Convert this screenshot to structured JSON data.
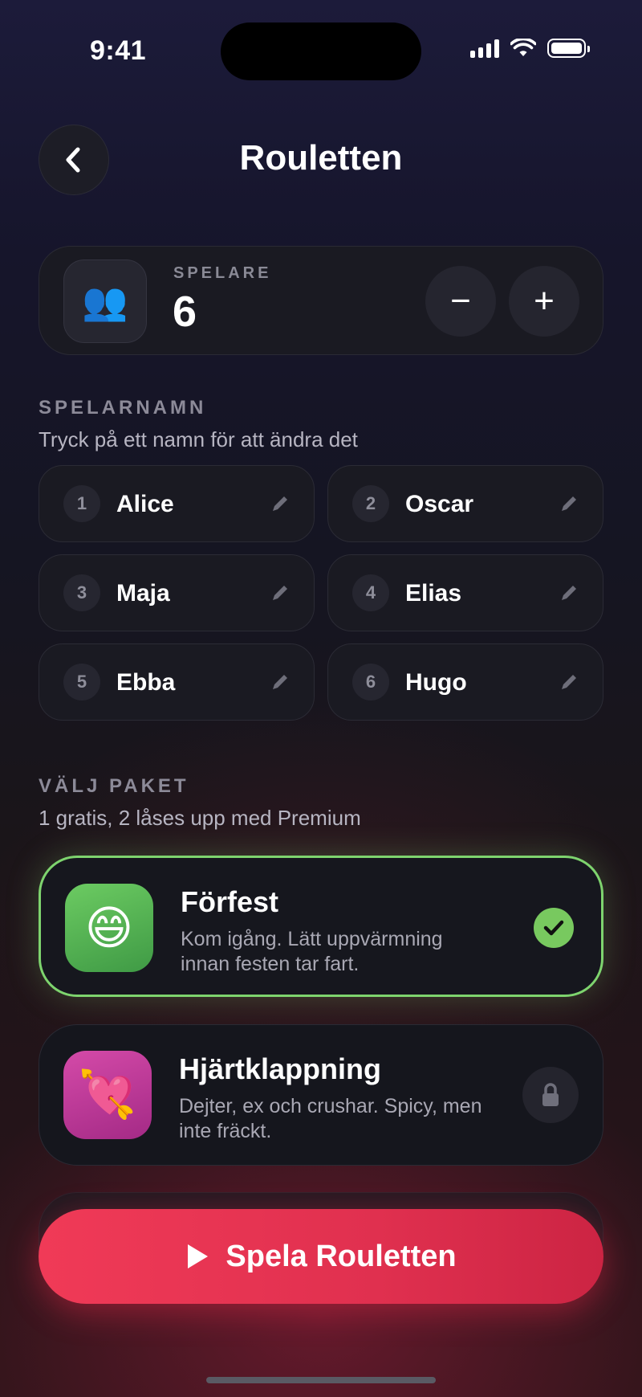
{
  "status_bar": {
    "time": "9:41"
  },
  "header": {
    "title": "Rouletten"
  },
  "players": {
    "label": "SPELARE",
    "count": "6",
    "minus": "−",
    "plus": "+",
    "icon": "people-icon"
  },
  "names_section": {
    "label": "SPELARNAMN",
    "subtitle": "Tryck på ett namn för att ändra det",
    "players": [
      {
        "num": "1",
        "name": "Alice"
      },
      {
        "num": "2",
        "name": "Oscar"
      },
      {
        "num": "3",
        "name": "Maja"
      },
      {
        "num": "4",
        "name": "Elias"
      },
      {
        "num": "5",
        "name": "Ebba"
      },
      {
        "num": "6",
        "name": "Hugo"
      }
    ]
  },
  "packages_section": {
    "label": "VÄLJ PAKET",
    "subtitle": "1 gratis, 2 låses upp med Premium",
    "packages": [
      {
        "title": "Förfest",
        "desc": "Kom igång. Lätt uppvärmning innan festen tar fart.",
        "emoji": "😄",
        "state": "selected"
      },
      {
        "title": "Hjärtklappning",
        "desc": "Dejter, ex och crushar. Spicy, men inte fräckt.",
        "emoji": "💘",
        "state": "locked"
      }
    ]
  },
  "play_button": {
    "label": "Spela Rouletten"
  },
  "colors": {
    "accent_red": "#e83250",
    "selected_green": "#7ed46e"
  }
}
